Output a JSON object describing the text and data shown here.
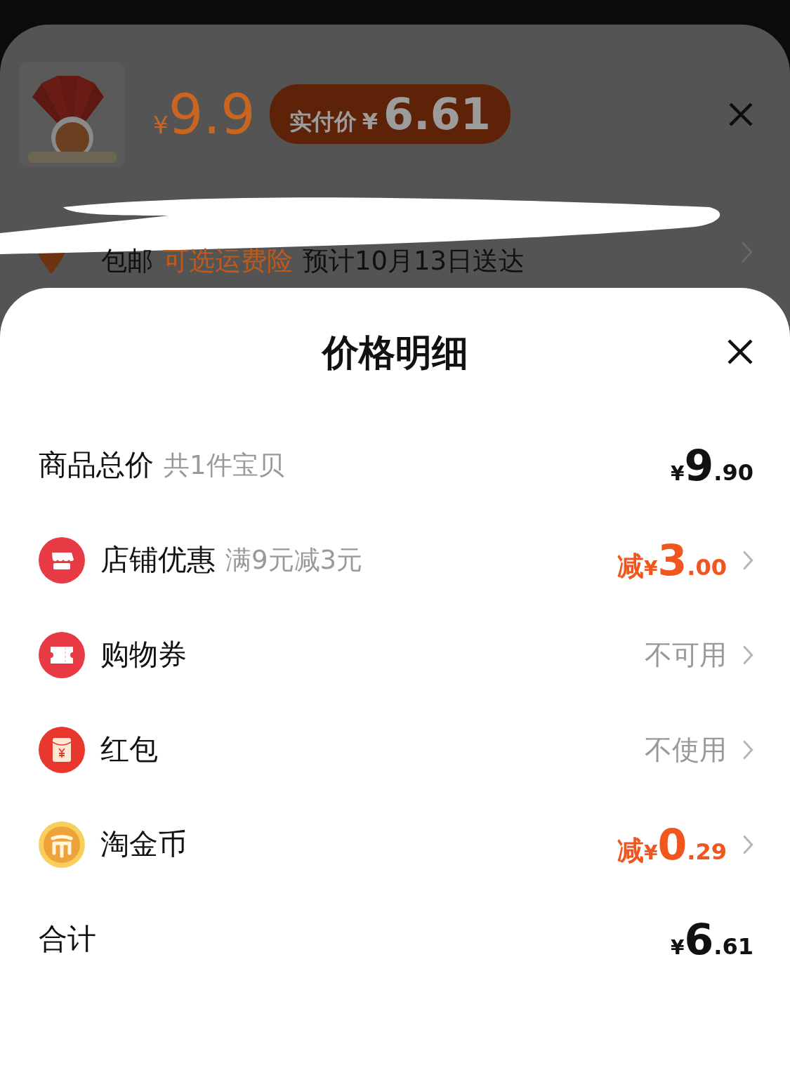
{
  "product": {
    "price": {
      "currency": "¥",
      "value": "9.9"
    },
    "paid_badge": {
      "label": "实付价",
      "currency": "¥",
      "value": "6.61"
    }
  },
  "delivery": {
    "shipping": "包邮",
    "insurance": "可选运费险",
    "eta": "预计10月13日送达"
  },
  "sheet": {
    "title": "价格明细",
    "rows": [
      {
        "kind": "plain",
        "label": "商品总价",
        "note": "共1件宝贝",
        "value": {
          "kind": "amount",
          "highlighted": false,
          "currency": "¥",
          "integer": "9",
          "decimal": ".90"
        },
        "chevron": false
      },
      {
        "kind": "store",
        "label": "店铺优惠",
        "note": "满9元减3元",
        "value": {
          "kind": "amount",
          "highlighted": true,
          "prefix": "减",
          "currency": "¥",
          "integer": "3",
          "decimal": ".00"
        },
        "chevron": true
      },
      {
        "kind": "coupon",
        "label": "购物券",
        "value": {
          "kind": "text",
          "text": "不可用"
        },
        "chevron": true
      },
      {
        "kind": "envelope",
        "label": "红包",
        "value": {
          "kind": "text",
          "text": "不使用"
        },
        "chevron": true
      },
      {
        "kind": "coin",
        "label": "淘金币",
        "value": {
          "kind": "amount",
          "highlighted": true,
          "prefix": "减",
          "currency": "¥",
          "integer": "0",
          "decimal": ".29"
        },
        "chevron": true
      },
      {
        "kind": "plain",
        "label": "合计",
        "value": {
          "kind": "amount",
          "highlighted": false,
          "currency": "¥",
          "integer": "6",
          "decimal": ".61"
        },
        "chevron": false
      }
    ]
  }
}
